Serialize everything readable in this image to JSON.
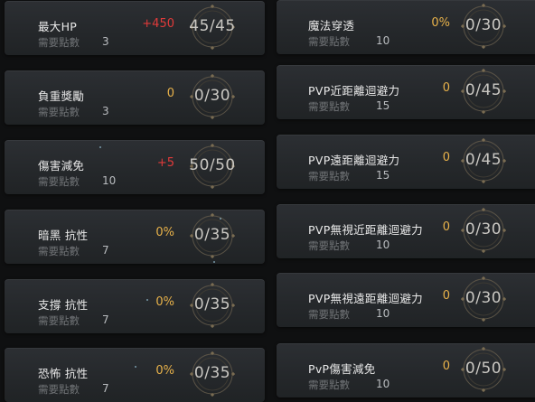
{
  "colors": {
    "positive": "#e03a3a",
    "neutral": "#e8b24a"
  },
  "left": [
    {
      "name": "最大HP",
      "req_label": "需要點數",
      "cost": "3",
      "bonus": "+450",
      "bonus_color": "positive",
      "progress": "45/45"
    },
    {
      "name": "負重獎勵",
      "req_label": "需要點數",
      "cost": "3",
      "bonus": "0",
      "bonus_color": "neutral",
      "progress": "0/30"
    },
    {
      "name": "傷害減免",
      "req_label": "需要點數",
      "cost": "10",
      "bonus": "+5",
      "bonus_color": "positive",
      "progress": "50/50"
    },
    {
      "name": "暗黑 抗性",
      "req_label": "需要點數",
      "cost": "7",
      "bonus": "0%",
      "bonus_color": "neutral",
      "progress": "0/35"
    },
    {
      "name": "支撐 抗性",
      "req_label": "需要點數",
      "cost": "7",
      "bonus": "0%",
      "bonus_color": "neutral",
      "progress": "0/35"
    },
    {
      "name": "恐怖 抗性",
      "req_label": "需要點數",
      "cost": "7",
      "bonus": "0%",
      "bonus_color": "neutral",
      "progress": "0/35"
    }
  ],
  "right": [
    {
      "name": "魔法穿透",
      "req_label": "需要點數",
      "cost": "10",
      "bonus": "0%",
      "bonus_color": "neutral",
      "progress": "0/30"
    },
    {
      "name": "PVP近距離迴避力",
      "req_label": "需要點數",
      "cost": "15",
      "bonus": "0",
      "bonus_color": "neutral",
      "progress": "0/45"
    },
    {
      "name": "PVP遠距離迴避力",
      "req_label": "需要點數",
      "cost": "15",
      "bonus": "0",
      "bonus_color": "neutral",
      "progress": "0/45"
    },
    {
      "name": "PVP無視近距離迴避力",
      "req_label": "需要點數",
      "cost": "10",
      "bonus": "0",
      "bonus_color": "neutral",
      "progress": "0/30"
    },
    {
      "name": "PVP無視遠距離迴避力",
      "req_label": "需要點數",
      "cost": "10",
      "bonus": "0",
      "bonus_color": "neutral",
      "progress": "0/30"
    },
    {
      "name": "PvP傷害減免",
      "req_label": "需要點數",
      "cost": "10",
      "bonus": "0",
      "bonus_color": "neutral",
      "progress": "0/50"
    }
  ]
}
